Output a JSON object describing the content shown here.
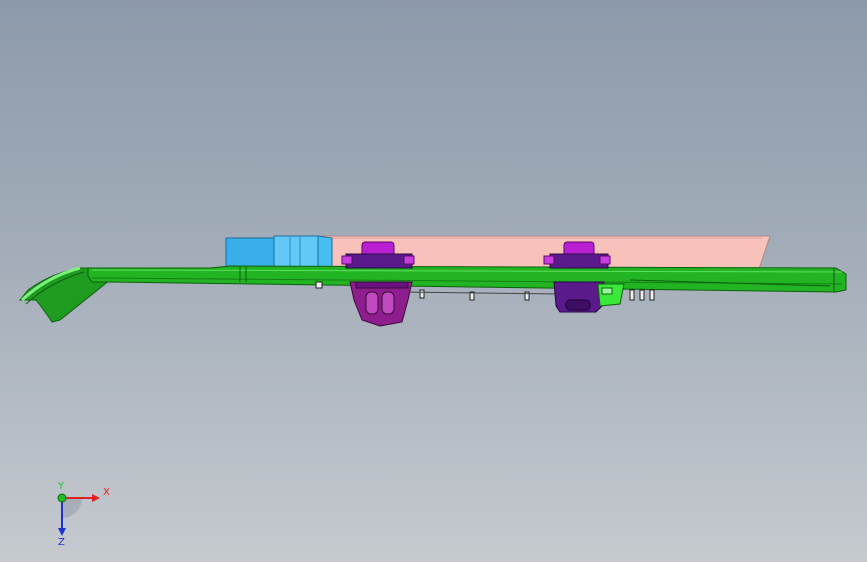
{
  "viewport": {
    "background_top": "#8d9aab",
    "background_bottom": "#c6cacf"
  },
  "model": {
    "parts": [
      {
        "name": "main-rail",
        "color": "#22b422"
      },
      {
        "name": "blue-block",
        "color": "#3db8f0"
      },
      {
        "name": "pink-cover",
        "color": "#f8c0b8"
      },
      {
        "name": "magenta-clip-left",
        "color": "#b01ec8"
      },
      {
        "name": "magenta-clip-right",
        "color": "#b01ec8"
      },
      {
        "name": "purple-housing",
        "color": "#5a1a8c"
      },
      {
        "name": "green-connector",
        "color": "#38e838"
      }
    ]
  },
  "triad": {
    "x_label": "X",
    "y_label": "Y",
    "z_label": "Z",
    "x_color": "#e02020",
    "y_color": "#20c020",
    "z_color": "#2030d0"
  }
}
